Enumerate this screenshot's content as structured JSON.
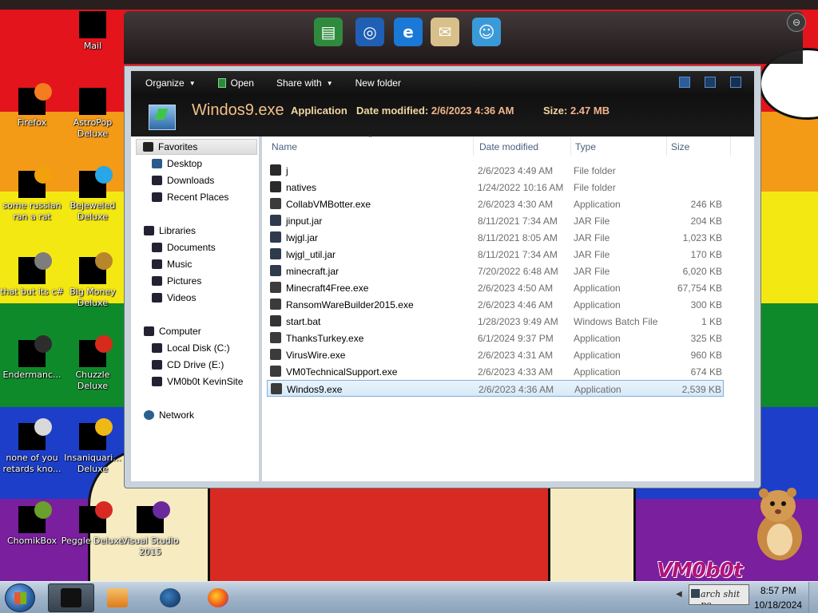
{
  "desktop": {
    "icons": [
      {
        "label": "Mail",
        "color": "#000000",
        "tint": ""
      },
      {
        "label": "Firefox",
        "color": "#000000",
        "tint": "#f57c1f"
      },
      {
        "label": "AstroPop Deluxe",
        "color": "#000000",
        "tint": ""
      },
      {
        "label": "some russian ran a rat",
        "color": "#000000",
        "tint": "#f0a10b"
      },
      {
        "label": "Bejeweled Deluxe",
        "color": "#000000",
        "tint": "#27a6e8"
      },
      {
        "label": "that but its c#",
        "color": "#000000",
        "tint": "#7d7d7d"
      },
      {
        "label": "Big Money Deluxe",
        "color": "#000000",
        "tint": "#b8862b"
      },
      {
        "label": "Endermanc...",
        "color": "#000000",
        "tint": "#2d2d2d"
      },
      {
        "label": "Chuzzle Deluxe",
        "color": "#000000",
        "tint": "#d82a1a"
      },
      {
        "label": "none of you retards kno...",
        "color": "#000000",
        "tint": "#d9d9d9"
      },
      {
        "label": "Insaniquari... Deluxe",
        "color": "#000000",
        "tint": "#f0b814"
      },
      {
        "label": "ChomikBox",
        "color": "#000000",
        "tint": "#6aa02c"
      },
      {
        "label": "Peggle Deluxe",
        "color": "#000000",
        "tint": "#d72a22"
      },
      {
        "label": "Visual Studio 2015",
        "color": "#000000",
        "tint": "#6a2a9e"
      }
    ],
    "watermark": "VM0b0t"
  },
  "dock": {
    "items": [
      {
        "name": "green-book-icon",
        "color": "#2e8b3e",
        "glyph": "▤"
      },
      {
        "name": "globe-download-icon",
        "color": "#1f5fb5",
        "glyph": "◎"
      },
      {
        "name": "internet-explorer-icon",
        "color": "#1a78d6",
        "glyph": "e"
      },
      {
        "name": "envelope-icon",
        "color": "#d8c08a",
        "glyph": "✉"
      },
      {
        "name": "users-icon",
        "color": "#3a9ad9",
        "glyph": "☺"
      }
    ]
  },
  "explorer": {
    "toolbar": {
      "organize": "Organize",
      "open": "Open",
      "share_with": "Share with",
      "new_folder": "New folder"
    },
    "details": {
      "name": "Windos9.exe",
      "type": "Application",
      "modified_label": "Date modified:",
      "modified_value": "2/6/2023 4:36 AM",
      "size_label": "Size:",
      "size_value": "2.47 MB"
    },
    "nav": {
      "favorites": "Favorites",
      "desktop": "Desktop",
      "downloads": "Downloads",
      "recent_places": "Recent Places",
      "libraries": "Libraries",
      "documents": "Documents",
      "music": "Music",
      "pictures": "Pictures",
      "videos": "Videos",
      "computer": "Computer",
      "local_disk": "Local Disk (C:)",
      "cd_drive": "CD Drive (E:)",
      "vm_site": "VM0b0t KevinSite",
      "network": "Network"
    },
    "columns": {
      "name": "Name",
      "date_modified": "Date modified",
      "type": "Type",
      "size": "Size"
    },
    "files": [
      {
        "name": "j",
        "date": "2/6/2023 4:49 AM",
        "type": "File folder",
        "size": ""
      },
      {
        "name": "natives",
        "date": "1/24/2022 10:16 AM",
        "type": "File folder",
        "size": ""
      },
      {
        "name": "CollabVMBotter.exe",
        "date": "2/6/2023 4:30 AM",
        "type": "Application",
        "size": "246 KB"
      },
      {
        "name": "jinput.jar",
        "date": "8/11/2021 7:34 AM",
        "type": "JAR File",
        "size": "204 KB"
      },
      {
        "name": "lwjgl.jar",
        "date": "8/11/2021 8:05 AM",
        "type": "JAR File",
        "size": "1,023 KB"
      },
      {
        "name": "lwjgl_util.jar",
        "date": "8/11/2021 7:34 AM",
        "type": "JAR File",
        "size": "170 KB"
      },
      {
        "name": "minecraft.jar",
        "date": "7/20/2022 6:48 AM",
        "type": "JAR File",
        "size": "6,020 KB"
      },
      {
        "name": "Minecraft4Free.exe",
        "date": "2/6/2023 4:50 AM",
        "type": "Application",
        "size": "67,754 KB"
      },
      {
        "name": "RansomWareBuilder2015.exe",
        "date": "2/6/2023 4:46 AM",
        "type": "Application",
        "size": "300 KB"
      },
      {
        "name": "start.bat",
        "date": "1/28/2023 9:49 AM",
        "type": "Windows Batch File",
        "size": "1 KB"
      },
      {
        "name": "ThanksTurkey.exe",
        "date": "6/1/2024 9:37 PM",
        "type": "Application",
        "size": "325 KB"
      },
      {
        "name": "VirusWire.exe",
        "date": "2/6/2023 4:31 AM",
        "type": "Application",
        "size": "960 KB"
      },
      {
        "name": "VM0TechnicalSupport.exe",
        "date": "2/6/2023 4:33 AM",
        "type": "Application",
        "size": "674 KB"
      },
      {
        "name": "Windos9.exe",
        "date": "2/6/2023 4:36 AM",
        "type": "Application",
        "size": "2,539 KB"
      }
    ],
    "selected_file": "Windos9.exe"
  },
  "taskbar": {
    "tray_thumb_text": "arch shit pe",
    "time": "8:57 PM",
    "date": "10/18/2024"
  }
}
